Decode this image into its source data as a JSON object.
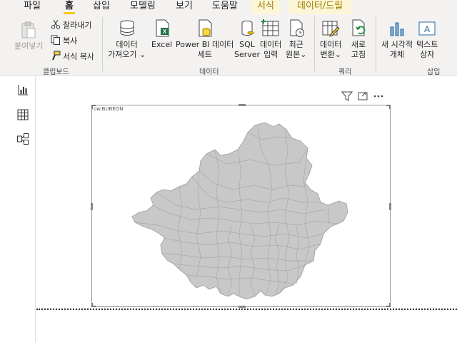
{
  "menu": {
    "tabs": [
      {
        "label": "파일"
      },
      {
        "label": "홈"
      },
      {
        "label": "삽입"
      },
      {
        "label": "모델링"
      },
      {
        "label": "보기"
      },
      {
        "label": "도움말"
      },
      {
        "label": "서식"
      },
      {
        "label": "데이터/드릴"
      }
    ]
  },
  "ribbon": {
    "clipboard": {
      "paste": "붙여넣기",
      "cut": "잘라내기",
      "copy": "복사",
      "format_painter": "서식 복사",
      "group": "클립보드"
    },
    "data": {
      "get_data": [
        "데이터",
        "가져오기 ⌄"
      ],
      "excel": "Excel",
      "power_bi": [
        "Power BI 데이터",
        "세트"
      ],
      "sql": [
        "SQL",
        "Server"
      ],
      "enter_data": [
        "데이터",
        "입력"
      ],
      "recent": [
        "최근",
        "원본⌄"
      ],
      "group": "데이터"
    },
    "queries": {
      "transform": [
        "데이터",
        "변환⌄"
      ],
      "refresh": [
        "새로",
        "고침"
      ],
      "group": "쿼리"
    },
    "insert": {
      "new_visual": [
        "새 시각적",
        "개체"
      ],
      "text_box": [
        "텍스트",
        "상자"
      ],
      "group": "삽입"
    }
  },
  "visual": {
    "title": "ow.BUBEON"
  },
  "colors": {
    "accent": "#f2c811",
    "map_fill": "#c8c8c8",
    "map_stroke": "#a6a6a6"
  }
}
